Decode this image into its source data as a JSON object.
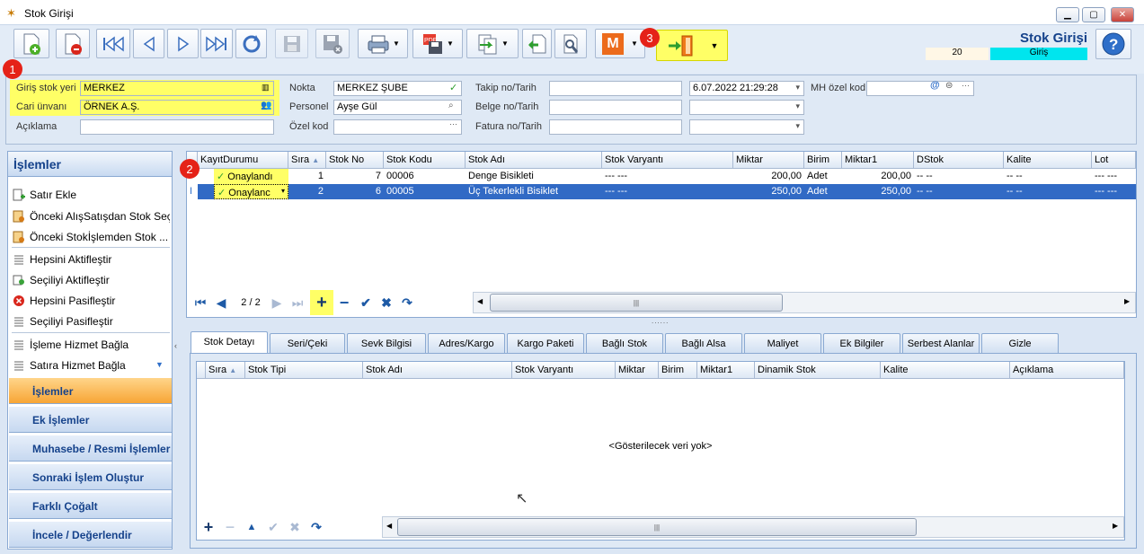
{
  "window": {
    "title": "Stok Girişi",
    "minimize": "▁",
    "maximize": "▢",
    "close": "✕"
  },
  "toolbar": {
    "title": "Stok Girişi",
    "count": "20",
    "mode": "Giriş",
    "m_label": "M",
    "badge3": "3",
    "icons": [
      "new-doc-icon",
      "delete-doc-icon",
      "first-icon",
      "prev-icon",
      "next-icon",
      "last-icon",
      "refresh-icon",
      "save-disabled-icon",
      "save-delete-icon",
      "print-icon",
      "pdf-save-icon",
      "transfer-icon",
      "import-icon",
      "tools-icon",
      "m-icon",
      "exit-door-icon",
      "help-icon"
    ]
  },
  "form": {
    "badge1": "1",
    "giris_stok_yeri_label": "Giriş stok yeri",
    "giris_stok_yeri": "MERKEZ",
    "cari_unvani_label": "Cari ünvanı",
    "cari_unvani": "ÖRNEK A.Ş.",
    "aciklama_label": "Açıklama",
    "aciklama": "",
    "nokta_label": "Nokta",
    "nokta": "MERKEZ ŞUBE",
    "personel_label": "Personel",
    "personel": "Ayşe Gül",
    "ozel_kod_label": "Özel kod",
    "ozel_kod": "",
    "takip_label": "Takip no/Tarih",
    "takip_no": "",
    "takip_tarih": "6.07.2022 21:29:28",
    "belge_label": "Belge no/Tarih",
    "fatura_label": "Fatura no/Tarih",
    "mh_ozel_kod_label": "MH özel kod",
    "mh_ozel_kod": "",
    "ellipsis": "···"
  },
  "leftpanel": {
    "title": "İşlemler",
    "items": [
      {
        "label": "Satır Ekle",
        "icon": "add-row-icon"
      },
      {
        "label": "Önceki AlışSatışdan Stok Seç",
        "icon": "select-from-purchase-icon"
      },
      {
        "label": "Önceki Stokİşlemden Stok ...",
        "icon": "select-from-stock-icon"
      },
      {
        "label": "Hepsini Aktifleştir",
        "icon": "activate-all-icon"
      },
      {
        "label": "Seçiliyi Aktifleştir",
        "icon": "activate-selected-icon"
      },
      {
        "label": "Hepsini Pasifleştir",
        "icon": "deactivate-all-icon"
      },
      {
        "label": "Seçiliyi Pasifleştir",
        "icon": "deactivate-selected-icon"
      },
      {
        "label": "İşleme Hizmet Bağla",
        "icon": "link-service-icon"
      },
      {
        "label": "Satıra Hizmet Bağla",
        "icon": "link-row-service-icon"
      }
    ],
    "buttons": [
      "İşlemler",
      "Ek İşlemler",
      "Muhasebe / Resmi İşlemler",
      "Sonraki İşlem Oluştur",
      "Farklı Çoğalt",
      "İncele / Değerlendir"
    ]
  },
  "grid": {
    "badge2": "2",
    "columns": [
      "KayıtDurumu",
      "Sıra",
      "Stok No",
      "Stok Kodu",
      "Stok Adı",
      "Stok Varyantı",
      "Miktar",
      "Birim",
      "Miktar1",
      "DStok",
      "Kalite",
      "Lot"
    ],
    "rows": [
      {
        "durum": "Onaylandı",
        "sira": "1",
        "stok_no": "7",
        "stok_kodu": "00006",
        "stok_adi": "Denge Bisikleti",
        "varyant": "--- ---",
        "miktar": "200,00",
        "birim": "Adet",
        "miktar1": "200,00",
        "dstok": "-- --",
        "kalite": "-- --",
        "lot": "--- ---"
      },
      {
        "durum": "Onaylanc",
        "sira": "2",
        "stok_no": "6",
        "stok_kodu": "00005",
        "stok_adi": "Üç Tekerlekli Bisiklet",
        "varyant": "--- ---",
        "miktar": "250,00",
        "birim": "Adet",
        "miktar1": "250,00",
        "dstok": "-- --",
        "kalite": "-- --",
        "lot": "--- ---"
      }
    ],
    "pager": "2 / 2",
    "splitter": "......"
  },
  "tabs": [
    "Stok Detayı",
    "Seri/Çeki",
    "Sevk Bilgisi",
    "Adres/Kargo",
    "Kargo Paketi",
    "Bağlı Stok",
    "Bağlı Alsa",
    "Maliyet",
    "Ek Bilgiler",
    "Serbest Alanlar",
    "Gizle"
  ],
  "detail_grid": {
    "columns": [
      "Sıra",
      "Stok Tipi",
      "Stok Adı",
      "Stok Varyantı",
      "Miktar",
      "Birim",
      "Miktar1",
      "Dinamik Stok",
      "Kalite",
      "Açıklama"
    ],
    "empty_text": "<Gösterilecek veri yok>"
  },
  "colors": {
    "highlight": "#ffff66",
    "selected_row": "#316ac5",
    "active_button": "#f7a535",
    "badge": "#e52218",
    "mode_cell": "#00e5ee"
  }
}
